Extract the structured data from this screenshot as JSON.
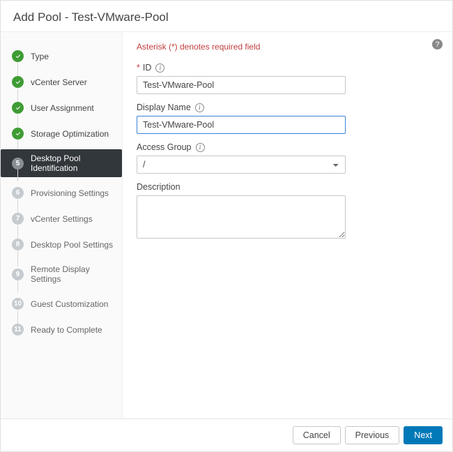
{
  "header": {
    "title": "Add Pool - Test-VMware-Pool"
  },
  "sidebar": {
    "steps": [
      {
        "num": "1",
        "label": "Type",
        "state": "done"
      },
      {
        "num": "2",
        "label": "vCenter Server",
        "state": "done"
      },
      {
        "num": "3",
        "label": "User Assignment",
        "state": "done"
      },
      {
        "num": "4",
        "label": "Storage Optimization",
        "state": "done"
      },
      {
        "num": "5",
        "label": "Desktop Pool Identification",
        "state": "current"
      },
      {
        "num": "6",
        "label": "Provisioning Settings",
        "state": "future"
      },
      {
        "num": "7",
        "label": "vCenter Settings",
        "state": "future"
      },
      {
        "num": "8",
        "label": "Desktop Pool Settings",
        "state": "future"
      },
      {
        "num": "9",
        "label": "Remote Display Settings",
        "state": "future"
      },
      {
        "num": "10",
        "label": "Guest Customization",
        "state": "future"
      },
      {
        "num": "11",
        "label": "Ready to Complete",
        "state": "future"
      }
    ]
  },
  "main": {
    "required_note": "Asterisk (*) denotes required field",
    "id_label": "ID",
    "id_value": "Test-VMware-Pool",
    "display_name_label": "Display Name",
    "display_name_value": "Test-VMware-Pool",
    "access_group_label": "Access Group",
    "access_group_value": "/",
    "description_label": "Description",
    "description_value": ""
  },
  "footer": {
    "cancel": "Cancel",
    "previous": "Previous",
    "next": "Next"
  },
  "help_glyph": "?"
}
